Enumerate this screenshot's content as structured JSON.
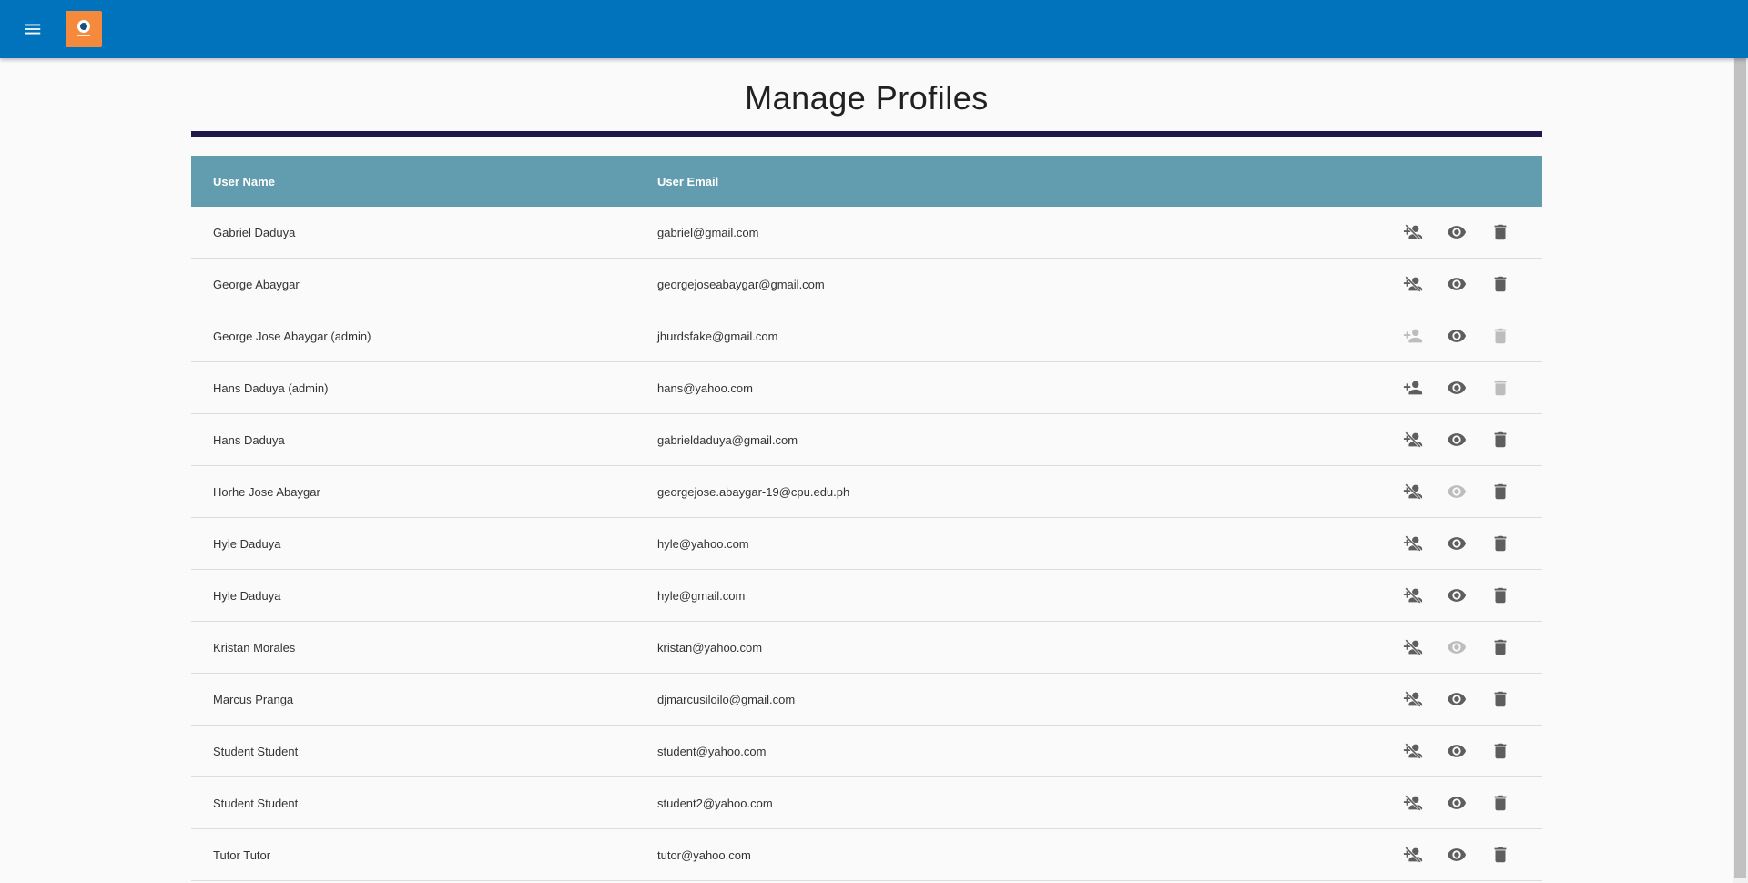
{
  "header": {
    "menu_icon": "menu-icon",
    "logo_icon": "app-logo",
    "brand_color": "#0073bc"
  },
  "page": {
    "title": "Manage Profiles"
  },
  "table": {
    "headers": {
      "name": "User Name",
      "email": "User Email"
    },
    "rows": [
      {
        "name": "Gabriel Daduya",
        "email": "gabriel@gmail.com",
        "promote_enabled": false,
        "view_enabled": true,
        "delete_enabled": true
      },
      {
        "name": "George Abaygar",
        "email": "georgejoseabaygar@gmail.com",
        "promote_enabled": false,
        "view_enabled": true,
        "delete_enabled": true
      },
      {
        "name": "George Jose Abaygar (admin)",
        "email": "jhurdsfake@gmail.com",
        "promote_enabled": true,
        "view_enabled": true,
        "delete_enabled": false,
        "promote_dimmed": true
      },
      {
        "name": "Hans Daduya (admin)",
        "email": "hans@yahoo.com",
        "promote_enabled": true,
        "view_enabled": true,
        "delete_enabled": false
      },
      {
        "name": "Hans Daduya",
        "email": "gabrieldaduya@gmail.com",
        "promote_enabled": false,
        "view_enabled": true,
        "delete_enabled": true
      },
      {
        "name": "Horhe Jose Abaygar",
        "email": "georgejose.abaygar-19@cpu.edu.ph",
        "promote_enabled": false,
        "view_enabled": false,
        "delete_enabled": true
      },
      {
        "name": "Hyle Daduya",
        "email": "hyle@yahoo.com",
        "promote_enabled": false,
        "view_enabled": true,
        "delete_enabled": true
      },
      {
        "name": "Hyle Daduya",
        "email": "hyle@gmail.com",
        "promote_enabled": false,
        "view_enabled": true,
        "delete_enabled": true
      },
      {
        "name": "Kristan Morales",
        "email": "kristan@yahoo.com",
        "promote_enabled": false,
        "view_enabled": false,
        "delete_enabled": true
      },
      {
        "name": "Marcus Pranga",
        "email": "djmarcusiloilo@gmail.com",
        "promote_enabled": false,
        "view_enabled": true,
        "delete_enabled": true
      },
      {
        "name": "Student Student",
        "email": "student@yahoo.com",
        "promote_enabled": false,
        "view_enabled": true,
        "delete_enabled": true
      },
      {
        "name": "Student Student",
        "email": "student2@yahoo.com",
        "promote_enabled": false,
        "view_enabled": true,
        "delete_enabled": true
      },
      {
        "name": "Tutor Tutor",
        "email": "tutor@yahoo.com",
        "promote_enabled": false,
        "view_enabled": true,
        "delete_enabled": true
      }
    ]
  }
}
